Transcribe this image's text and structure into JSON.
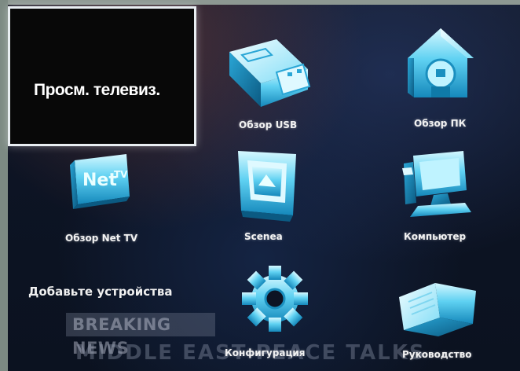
{
  "focus": {
    "label": "Просм. телевиз."
  },
  "items": [
    {
      "label": "Обзор USB",
      "icon": "usb-drive-icon"
    },
    {
      "label": "Обзор ПК",
      "icon": "home-pc-icon"
    },
    {
      "label": "Обзор Net TV",
      "icon": "net-tv-icon"
    },
    {
      "label": "Scenea",
      "icon": "picture-frame-icon"
    },
    {
      "label": "Компьютер",
      "icon": "computer-icon"
    },
    {
      "label": "Конфигурация",
      "icon": "gear-icon"
    },
    {
      "label": "Руководство",
      "icon": "open-book-icon"
    }
  ],
  "add_devices": {
    "label": "Добавьте устройства"
  },
  "background_ticker": {
    "line1": "BREAKING NEWS",
    "line2": "MIDDLE EAST PEACE TALKS"
  },
  "colors": {
    "icon_light": "#b8f2ff",
    "icon_mid": "#3fc3ea",
    "icon_dark": "#0e6f9a",
    "focus_border": "#e9eef2"
  }
}
